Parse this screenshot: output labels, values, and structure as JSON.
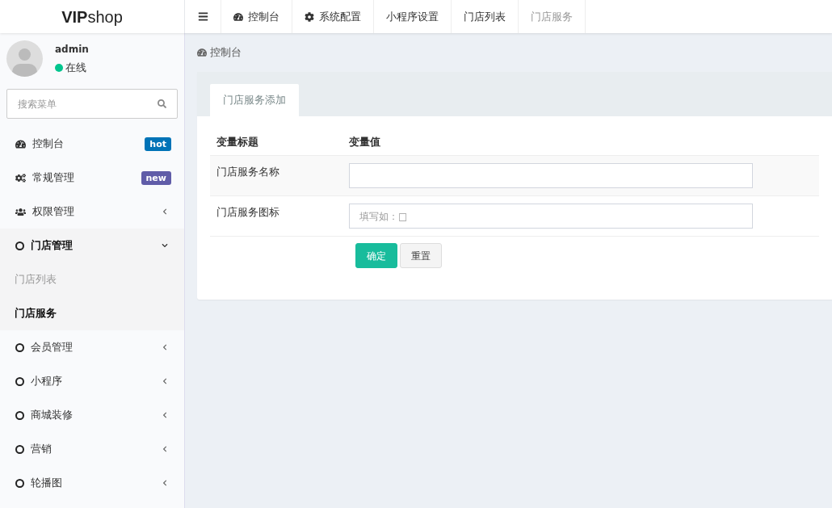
{
  "logo": "**VIP**shop",
  "topnav": [
    {
      "label": "控制台",
      "selected": false
    },
    {
      "label": "系统配置",
      "selected": false
    },
    {
      "label": "小程序设置",
      "selected": false
    },
    {
      "label": "门店列表",
      "selected": false
    },
    {
      "label": "门店服务",
      "selected": true
    }
  ],
  "user": {
    "name": "admin",
    "status": "在线"
  },
  "search": {
    "placeholder": "搜索菜单"
  },
  "sidebar": {
    "items": [
      {
        "label": "控制台",
        "kind": "badge",
        "badge": "hot",
        "color": "#0073b7",
        "expanded": false
      },
      {
        "label": "常规管理",
        "kind": "badge",
        "badge": "new",
        "color": "#605ca8",
        "expanded": false
      },
      {
        "label": "权限管理",
        "kind": "folder",
        "expanded": false
      },
      {
        "label": "门店管理",
        "kind": "folder",
        "expanded": true,
        "children": [
          {
            "label": "门店列表",
            "selected": false
          },
          {
            "label": "门店服务",
            "selected": true
          }
        ]
      },
      {
        "label": "会员管理",
        "kind": "folder",
        "expanded": false
      },
      {
        "label": "小程序",
        "kind": "folder",
        "expanded": false
      },
      {
        "label": "商城装修",
        "kind": "folder",
        "expanded": false
      },
      {
        "label": "营销",
        "kind": "folder",
        "expanded": false
      },
      {
        "label": "轮播图",
        "kind": "folder",
        "expanded": false
      }
    ]
  },
  "breadcrumb": "控制台",
  "panel": {
    "tab": "门店服务添加",
    "columns": [
      "变量标题",
      "变量值"
    ],
    "rows": [
      {
        "label": "门店服务名称",
        "value": ""
      },
      {
        "label": "门店服务图标",
        "placeholder": "填写如：□"
      }
    ],
    "buttons": [
      {
        "label": "确定",
        "kind": "primary"
      },
      {
        "label": "重置",
        "kind": "default"
      }
    ]
  }
}
